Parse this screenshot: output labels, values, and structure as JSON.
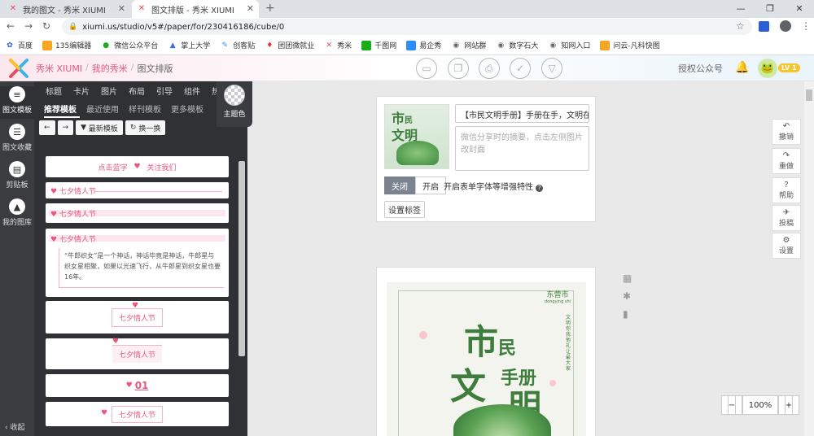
{
  "browser": {
    "tabs": [
      {
        "title": "我的图文 - 秀米 XIUMI",
        "active": false
      },
      {
        "title": "图文排版 - 秀米 XIUMI",
        "active": true
      }
    ],
    "new_tab": "+",
    "url": "xiumi.us/studio/v5#/paper/for/230416186/cube/0",
    "bookmarks": [
      {
        "label": "百度",
        "color": "#2a5fd6"
      },
      {
        "label": "135编辑器",
        "color": "#f5a623"
      },
      {
        "label": "微信公众平台",
        "color": "#1aad19"
      },
      {
        "label": "掌上大学",
        "color": "#3c6ee0"
      },
      {
        "label": "创客贴",
        "color": "#2a8cff"
      },
      {
        "label": "团团微就业",
        "color": "#e33"
      },
      {
        "label": "秀米",
        "color": "#e84a5f"
      },
      {
        "label": "千图网",
        "color": "#1aad19"
      },
      {
        "label": "易企秀",
        "color": "#2a8cff"
      },
      {
        "label": "网站群",
        "color": "#666"
      },
      {
        "label": "数字石大",
        "color": "#666"
      },
      {
        "label": "知网入口",
        "color": "#666"
      },
      {
        "label": "问云-凡科快图",
        "color": "#f5a623"
      }
    ]
  },
  "app": {
    "brand": "秀米 XIUMI",
    "crumbs": [
      "秀米 XIUMI",
      "/",
      "我的秀米",
      "/",
      "图文排版"
    ],
    "authorize": "授权公众号",
    "level": "LV 1",
    "accent": "#e8577c"
  },
  "rail": {
    "items": [
      "图文模板",
      "图文收藏",
      "剪贴板",
      "我的图库"
    ],
    "collapse": "收起"
  },
  "panel": {
    "categories": [
      "标题",
      "卡片",
      "图片",
      "布局",
      "引导",
      "组件",
      "热门"
    ],
    "subtabs": [
      "推荐模板",
      "最近使用",
      "样刊模板",
      "更多模板"
    ],
    "theme_color": "主题色",
    "toolbar": {
      "newest": "最新模板",
      "refresh": "换一换"
    }
  },
  "templates": {
    "c1_a": "点击蓝字",
    "c1_b": "关注我们",
    "festival": "七夕情人节",
    "body": "“牛郎织女”是一个神话，神话毕竟是神话，牛郎星与织女星相聚，如果以光速飞行，从牛郎星到织女星也要16年。",
    "num": "01"
  },
  "editor": {
    "title_value": "【市民文明手册】手册在手，文明在心",
    "summary_placeholder": "微信分享时的摘要，点击左侧图片改封面",
    "toggle_off": "关闭",
    "toggle_on": "开启",
    "toggle_label": "开启表单字体等增强特性",
    "set_label": "设置标签"
  },
  "poster": {
    "region": "东营市",
    "region_en": "dongying shi",
    "t1": "市",
    "t2": "民",
    "t3": "手册",
    "t4": "文",
    "t5": "明",
    "side_text": "文明你我他 礼让最大家"
  },
  "right_tools": [
    {
      "icon": "undo-icon",
      "label": "撤销",
      "glyph": "↶"
    },
    {
      "icon": "redo-icon",
      "label": "重做",
      "glyph": "↷"
    },
    {
      "icon": "help-icon",
      "label": "帮助",
      "glyph": "?"
    },
    {
      "icon": "submit-icon",
      "label": "投稿",
      "glyph": "✈"
    },
    {
      "icon": "settings-icon",
      "label": "设置",
      "glyph": "⚙"
    }
  ],
  "zoom": {
    "minus": "−",
    "level": "100%",
    "plus": "+"
  }
}
